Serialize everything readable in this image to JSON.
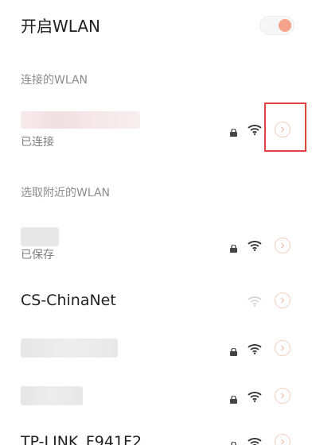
{
  "header": {
    "title": "开启WLAN",
    "wlan_enabled": true
  },
  "connected_section": {
    "label": "连接的WLAN",
    "network": {
      "status": "已连接",
      "secured": true,
      "icon": "wifi-icon"
    }
  },
  "nearby_section": {
    "label": "选取附近的WLAN",
    "networks": [
      {
        "name": "",
        "status": "已保存",
        "secured": true
      },
      {
        "name": "CS-ChinaNet",
        "status": "",
        "secured": false
      },
      {
        "name": "",
        "status": "",
        "secured": true
      },
      {
        "name": "",
        "status": "",
        "secured": true
      },
      {
        "name": "TP-LINK_F941F2",
        "status": "",
        "secured": true
      }
    ]
  },
  "colors": {
    "accent": "#f4a38a",
    "highlight_box": "#e0443f"
  }
}
